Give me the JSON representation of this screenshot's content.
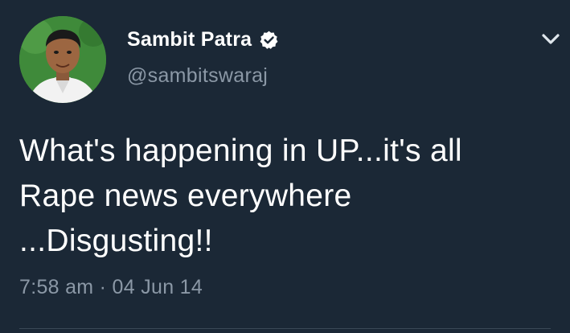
{
  "tweet": {
    "display_name": "Sambit Patra",
    "handle": "@sambitswaraj",
    "verified_icon": "verified-badge-icon",
    "menu_icon": "chevron-down-icon",
    "text": "What's happening in UP...it's all\nRape news everywhere\n...Disgusting!!",
    "timestamp": "7:58 am · 04 Jun 14"
  },
  "colors": {
    "background": "#1b2836",
    "text": "#ffffff",
    "muted": "#8b98a6",
    "avatar_bg": "#3f8a3a"
  }
}
